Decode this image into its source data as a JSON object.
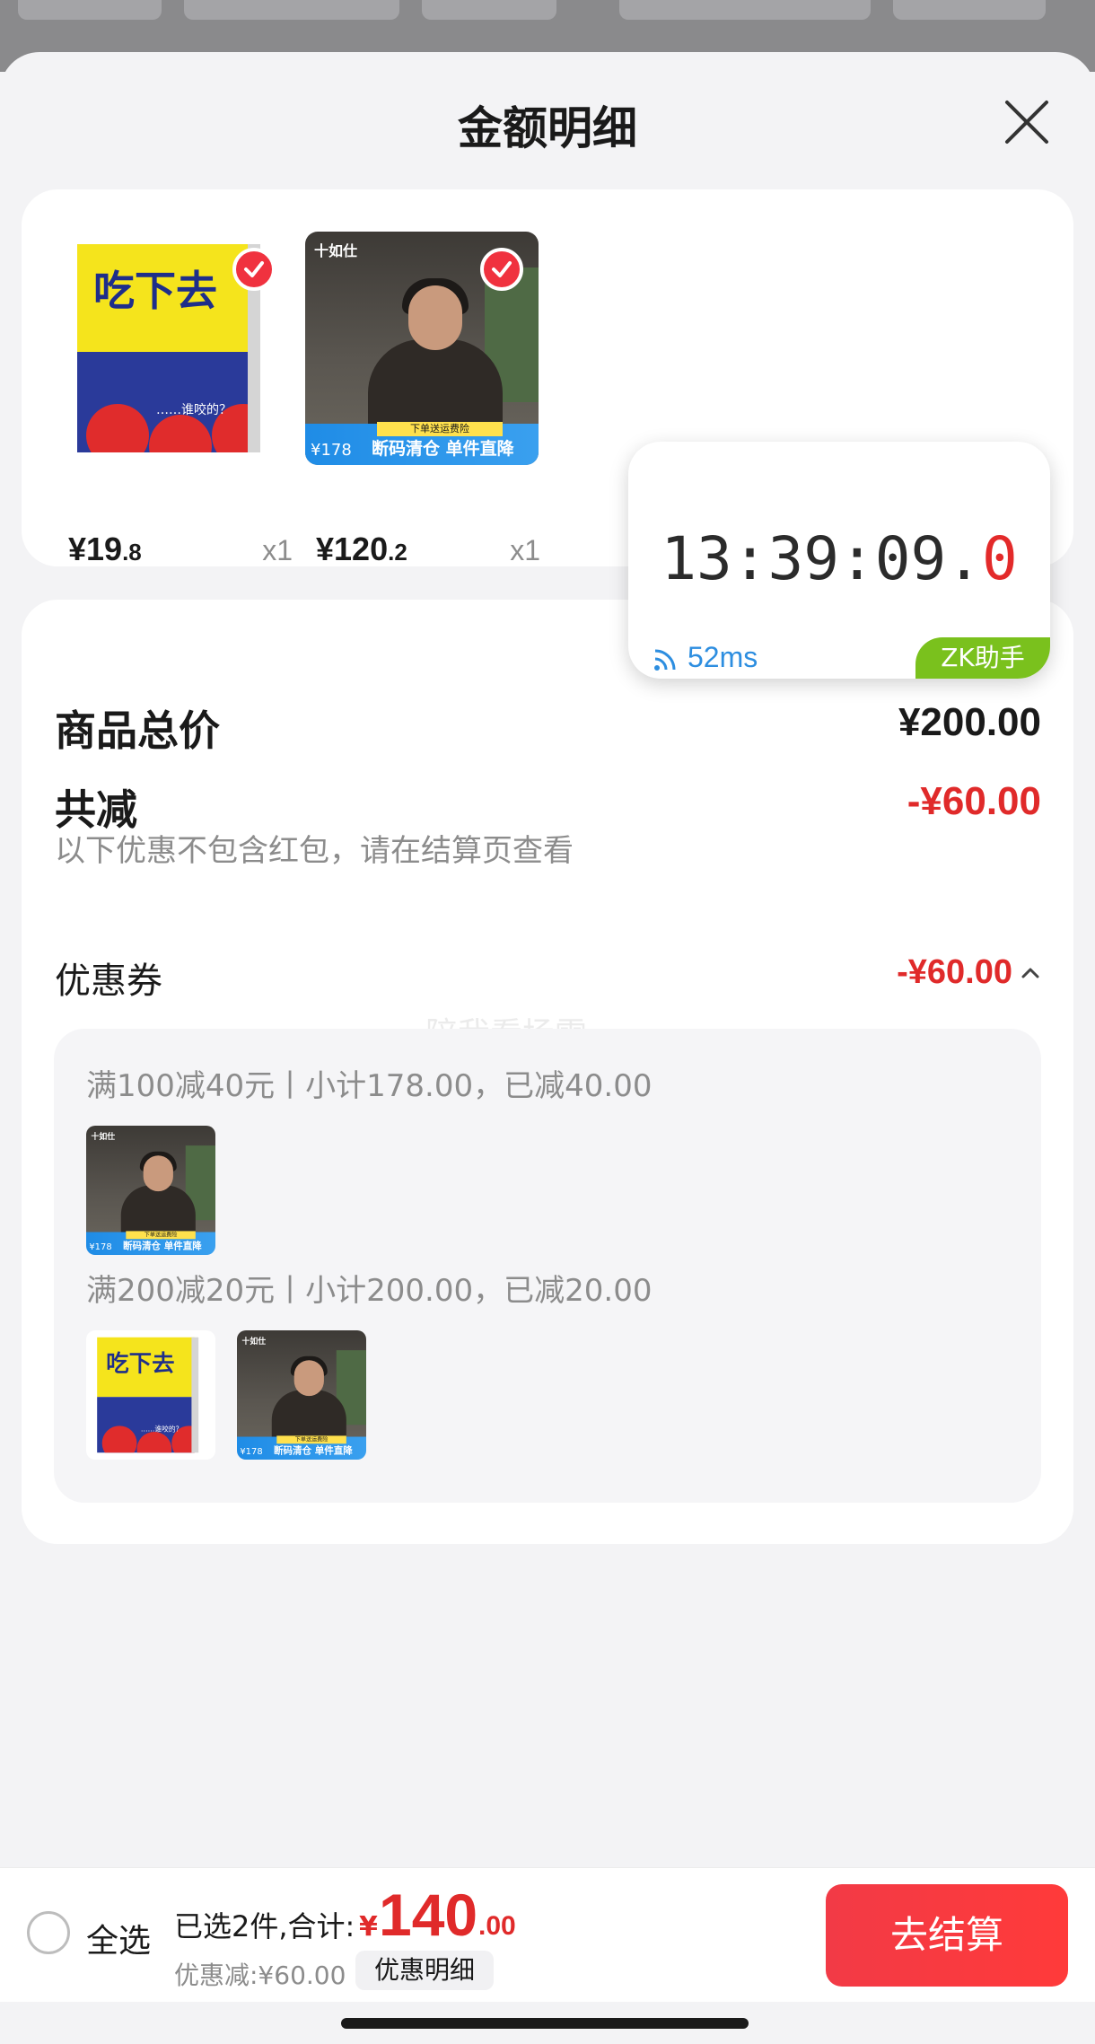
{
  "sheet": {
    "title": "金额明细",
    "close_icon": "close-icon"
  },
  "products": [
    {
      "price_int": "¥19",
      "price_dec": ".8",
      "qty": "x1",
      "image": "book-cover",
      "selected": true
    },
    {
      "price_int": "¥120",
      "price_dec": ".2",
      "qty": "x1",
      "image": "clothing-photo",
      "selected": true
    }
  ],
  "product_images": {
    "book_title": "吃下去",
    "book_subtitle": "……谁咬的？",
    "clothing_brand": "十如仕",
    "clothing_tag": "下单送运费险",
    "clothing_banner": "断码清仓 单件直降",
    "clothing_price": "¥178"
  },
  "timer": {
    "clock_main": "13:39:09.",
    "clock_ms": "0",
    "latency": "52ms",
    "badge": "ZK助手"
  },
  "breakdown": {
    "total_label": "商品总价",
    "total_value": "¥200.00",
    "reduce_label": "共减",
    "reduce_value": "-¥60.00",
    "note": "以下优惠不包含红包，请在结算页查看",
    "coupon_label": "优惠券",
    "coupon_value": "-¥60.00",
    "watermark": "陪我看场雪",
    "coupons": [
      {
        "rule": "满100减40元丨小计178.00，已减40.00"
      },
      {
        "rule": "满200减20元丨小计200.00，已减20.00"
      }
    ]
  },
  "bottom_bar": {
    "select_all": "全选",
    "summary": "已选2件,合计:",
    "total_symbol": "¥",
    "total_int": "140",
    "total_dec": ".00",
    "discount": "优惠减:¥60.00",
    "detail_button": "优惠明细",
    "checkout_button": "去结算"
  },
  "colors": {
    "accent_red": "#e02a2a",
    "checkout_red": "#f23a46",
    "latency_blue": "#2d8ee0",
    "badge_green": "#7ac11d"
  }
}
